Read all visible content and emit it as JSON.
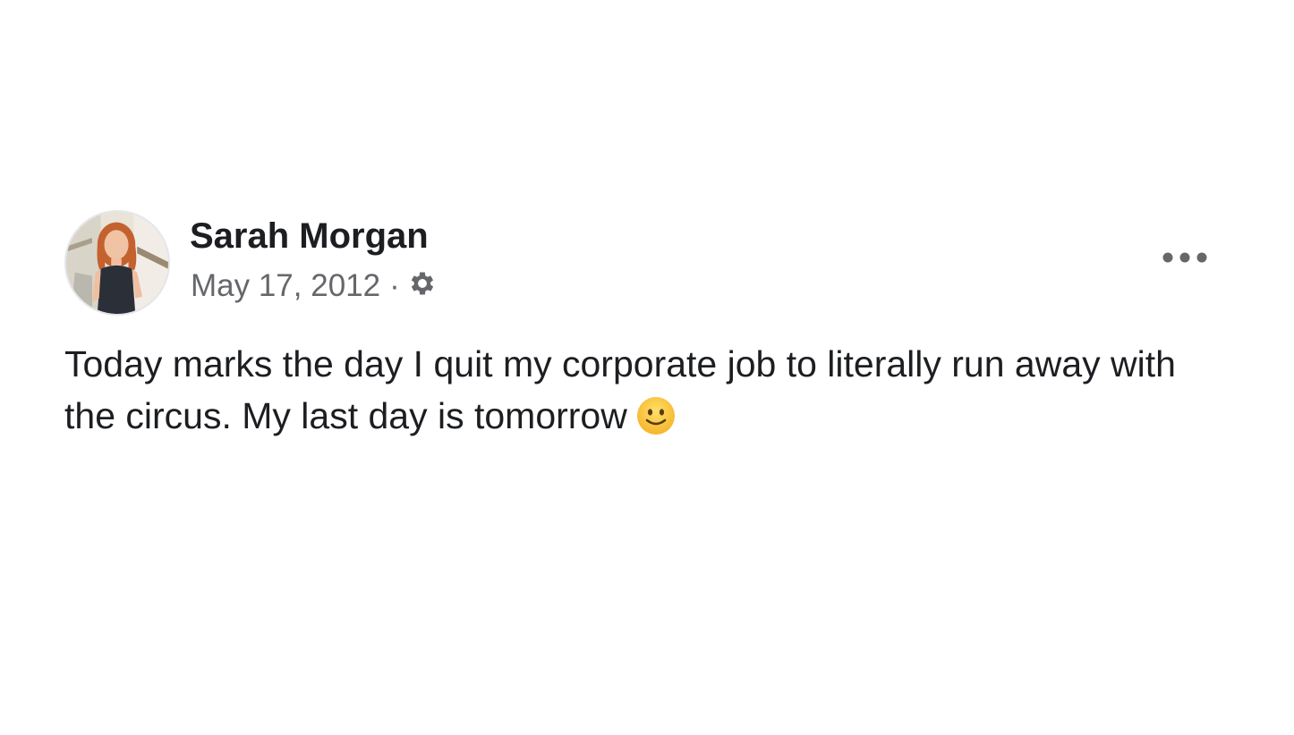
{
  "post": {
    "author": {
      "name": "Sarah Morgan",
      "avatar": "profile-photo"
    },
    "meta": {
      "date": "May 17, 2012",
      "separator": "·",
      "audience_icon": "gear-icon"
    },
    "menu_icon": "more-options-icon",
    "text": "Today marks the day I quit my corporate job to literally run away with the circus. My last day is tomorrow",
    "emoji": "slightly-smiling-face-icon"
  },
  "colors": {
    "background": "#ffffff",
    "primary_text": "#1c1e21",
    "secondary_text": "#65676b",
    "icon_gray": "#65676b"
  }
}
